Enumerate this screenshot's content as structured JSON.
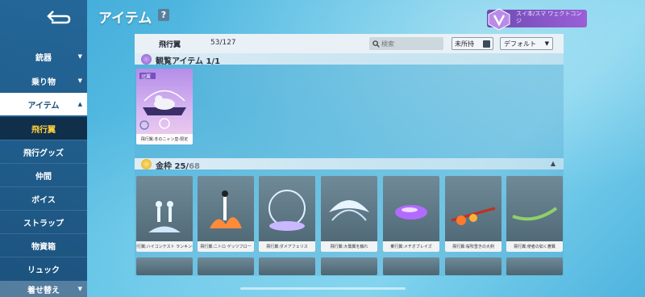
{
  "header": {
    "title": "アイテム",
    "help": "?",
    "user_name": "スイ本/スマ ワェクトコン ジ"
  },
  "sidebar": {
    "items": [
      {
        "label": "銃器",
        "chev": "▼"
      },
      {
        "label": "乗り物",
        "chev": "▼"
      },
      {
        "label": "アイテム",
        "chev": "▲"
      },
      {
        "label": "飛行翼",
        "chev": ""
      },
      {
        "label": "飛行グッズ",
        "chev": ""
      },
      {
        "label": "仲間",
        "chev": ""
      },
      {
        "label": "ボイス",
        "chev": ""
      },
      {
        "label": "ストラップ",
        "chev": ""
      },
      {
        "label": "物資箱",
        "chev": ""
      },
      {
        "label": "リュック",
        "chev": ""
      },
      {
        "label": "着せ替え",
        "chev": "▼"
      }
    ]
  },
  "toolbar": {
    "label": "飛行翼",
    "count": "53/127",
    "search_placeholder": "検索",
    "not_owned_label": "未所持",
    "sort_label": "デフォルト",
    "sort_chev": "▼"
  },
  "sections": [
    {
      "title": "観覧アイテム",
      "count": "1/1",
      "total": "",
      "collapse": ""
    },
    {
      "title": "金枠",
      "count": "25/",
      "total": "68",
      "collapse": "▲"
    }
  ],
  "cards_row0": [
    {
      "caption": "飛行翼:冬のニャン皇-限定",
      "art": "冠翼"
    }
  ],
  "cards_row1": [
    {
      "caption": "乗行翼:ハイコンテスト ランキング"
    },
    {
      "caption": "飛行翼:ニトロ ゲッツフロー"
    },
    {
      "caption": "飛行翼:ダメアフェリス"
    },
    {
      "caption": "飛行翼:大鷲翼を触れ"
    },
    {
      "caption": "乗行翼:メチオブレイズ"
    },
    {
      "caption": "飛行翼:桜吹雪きの大剣"
    },
    {
      "caption": "飛行翼:使者の如く蒼翼"
    }
  ],
  "colors": {
    "accent_gold": "#ffd33d",
    "sidebar": "#1e5a8c",
    "badge_purple": "#8a55c9"
  }
}
